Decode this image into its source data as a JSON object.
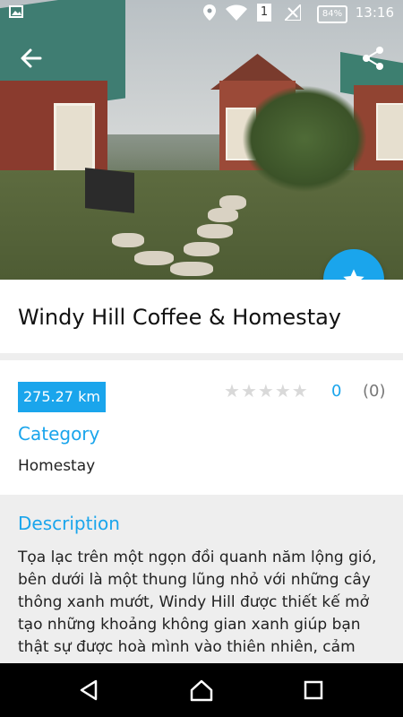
{
  "status_bar": {
    "time": "13:16",
    "battery": "84%",
    "sim": "1"
  },
  "header": {
    "back_icon": "arrow-left-icon",
    "share_icon": "share-icon"
  },
  "place": {
    "title": "Windy Hill Coffee & Homestay",
    "distance": "275.27 km",
    "rating_value": "0",
    "rating_count": "(0)",
    "category_label": "Category",
    "category_value": "Homestay",
    "description_label": "Description",
    "description_text": "Tọa lạc trên một ngọn đồi quanh năm lộng gió, bên dưới là một thung lũng nhỏ với những cây thông xanh mướt, Windy Hill được thiết kế mở tạo những khoảng không gian xanh giúp bạn thật sự được hoà mình vào thiên nhiên, cảm"
  },
  "colors": {
    "accent": "#1aa5ec",
    "band": "#eeeeee"
  }
}
